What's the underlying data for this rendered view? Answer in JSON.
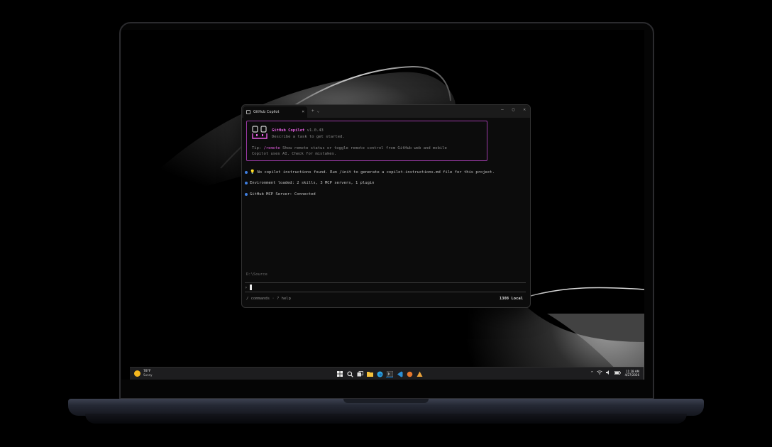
{
  "terminal": {
    "tab_title": "GitHub Copilot",
    "tab_close": "×",
    "new_tab": "+",
    "dropdown": "⌄",
    "minimize": "–",
    "maximize": "▢",
    "close": "✕",
    "banner": {
      "name": "GitHub Copilot",
      "version": "v1.0.43",
      "subtitle": "Describe a task to get started.",
      "tip_prefix": "Tip:",
      "tip_command": "/remote",
      "tip_text": "Show remote status or toggle remote control from GitHub web and mobile",
      "warning": "Copilot uses AI. Check for mistakes."
    },
    "messages": [
      "No copilot instructions found. Run /init to generate a copilot-instructions.md file for this project.",
      "Environment loaded: 2 skills, 3 MCP servers, 1 plugin",
      "GitHub MCP Server: Connected"
    ],
    "cwd": "D:\\Source",
    "prompt_symbol": "›",
    "hints": "/ commands · ? help",
    "status": "1308 Local"
  },
  "taskbar": {
    "weather_temp": "78°F",
    "weather_condition": "Sunny",
    "time": "11:28 AM",
    "date": "4/27/2026",
    "tray_chevron": "^",
    "icons": [
      "start-icon",
      "search-icon",
      "task-view-icon",
      "file-explorer-icon",
      "edge-icon",
      "terminal-icon",
      "vscode-icon",
      "app-icon",
      "app-icon-2"
    ],
    "accent": "#0078d4"
  },
  "colors": {
    "banner_border": "#9b3aa6",
    "brand_magenta": "#e35de0",
    "bullet_blue": "#3f7fe0"
  }
}
